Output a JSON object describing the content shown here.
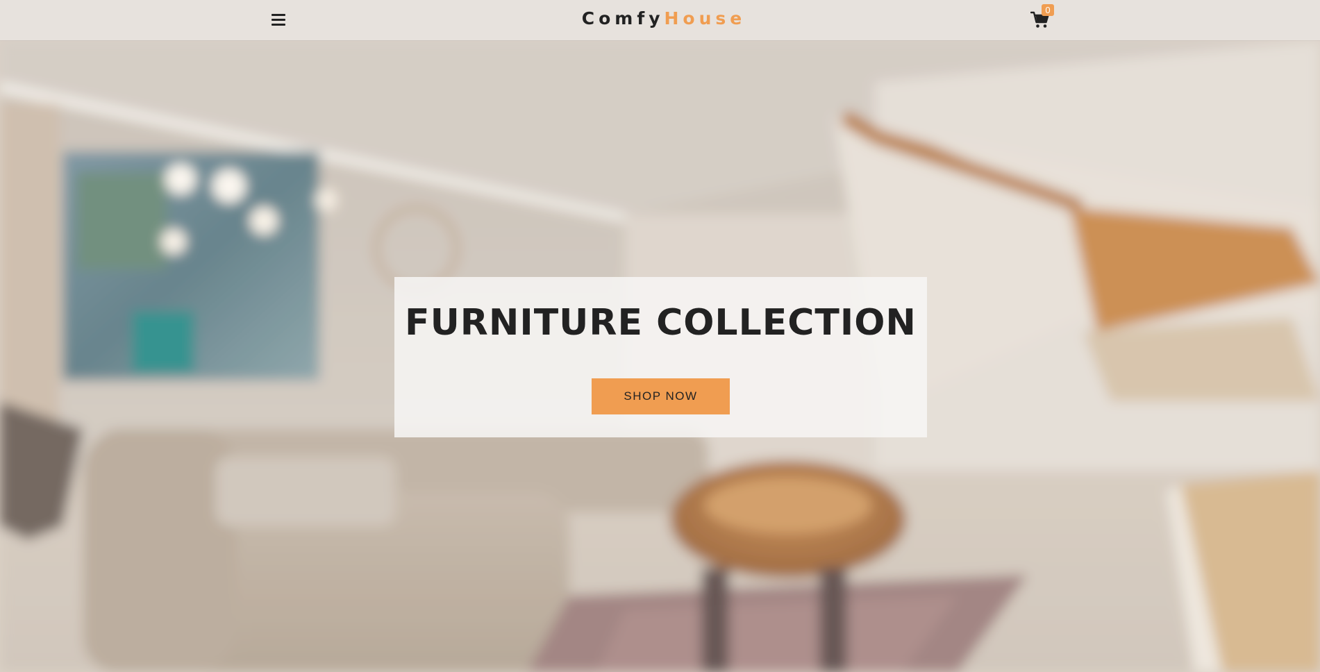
{
  "navbar": {
    "menu_icon": "hamburger-menu-icon",
    "logo_part1": "Comfy",
    "logo_part2": "House",
    "cart_icon": "shopping-cart-icon",
    "cart_count": "0"
  },
  "hero": {
    "background_image": "blurred-living-room-photo",
    "title": "FURNITURE COLLECTION",
    "cta_label": "SHOP NOW"
  },
  "colors": {
    "accent": "#f09d51",
    "navbar_bg": "#e7e2dd",
    "text_dark": "#222222"
  }
}
